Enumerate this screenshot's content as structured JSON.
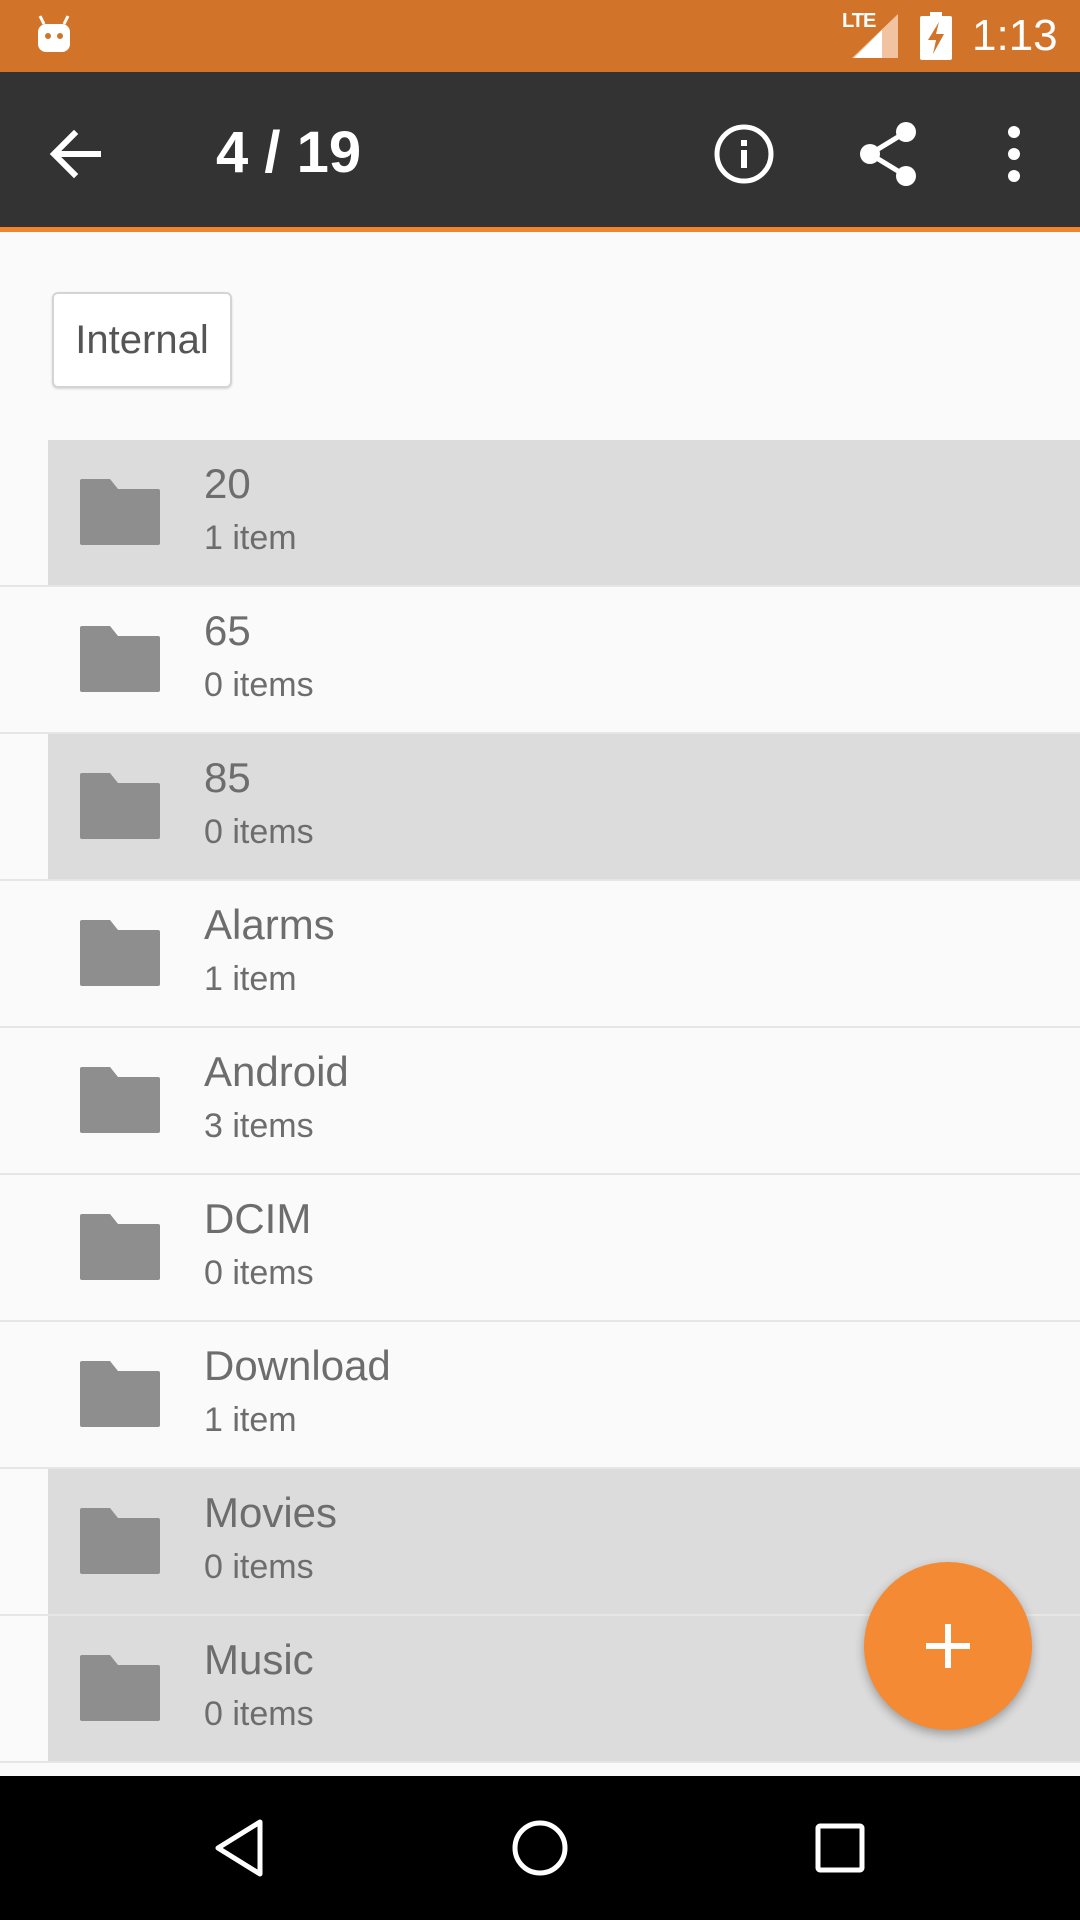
{
  "status_bar": {
    "network": "LTE",
    "time": "1:13",
    "icons": [
      "android-notification-icon",
      "signal-icon",
      "battery-charging-icon"
    ]
  },
  "toolbar": {
    "title": "4 / 19",
    "icons": [
      "back-arrow-icon",
      "info-icon",
      "share-icon",
      "more-vert-icon"
    ]
  },
  "storage_chip": {
    "label": "Internal"
  },
  "folders": [
    {
      "name": "20",
      "count": "1 item",
      "selected": true
    },
    {
      "name": "65",
      "count": "0 items",
      "selected": false
    },
    {
      "name": "85",
      "count": "0 items",
      "selected": true
    },
    {
      "name": "Alarms",
      "count": "1 item",
      "selected": false
    },
    {
      "name": "Android",
      "count": "3 items",
      "selected": false
    },
    {
      "name": "DCIM",
      "count": "0 items",
      "selected": false
    },
    {
      "name": "Download",
      "count": "1 item",
      "selected": false
    },
    {
      "name": "Movies",
      "count": "0 items",
      "selected": true
    },
    {
      "name": "Music",
      "count": "0 items",
      "selected": true
    }
  ],
  "fab": {
    "icon": "add-icon"
  },
  "colors": {
    "status_bar": "#d2732a",
    "toolbar": "#333333",
    "accent": "#f58a34",
    "selected_row": "#dcdcdc",
    "folder_icon": "#8e8e8e"
  }
}
